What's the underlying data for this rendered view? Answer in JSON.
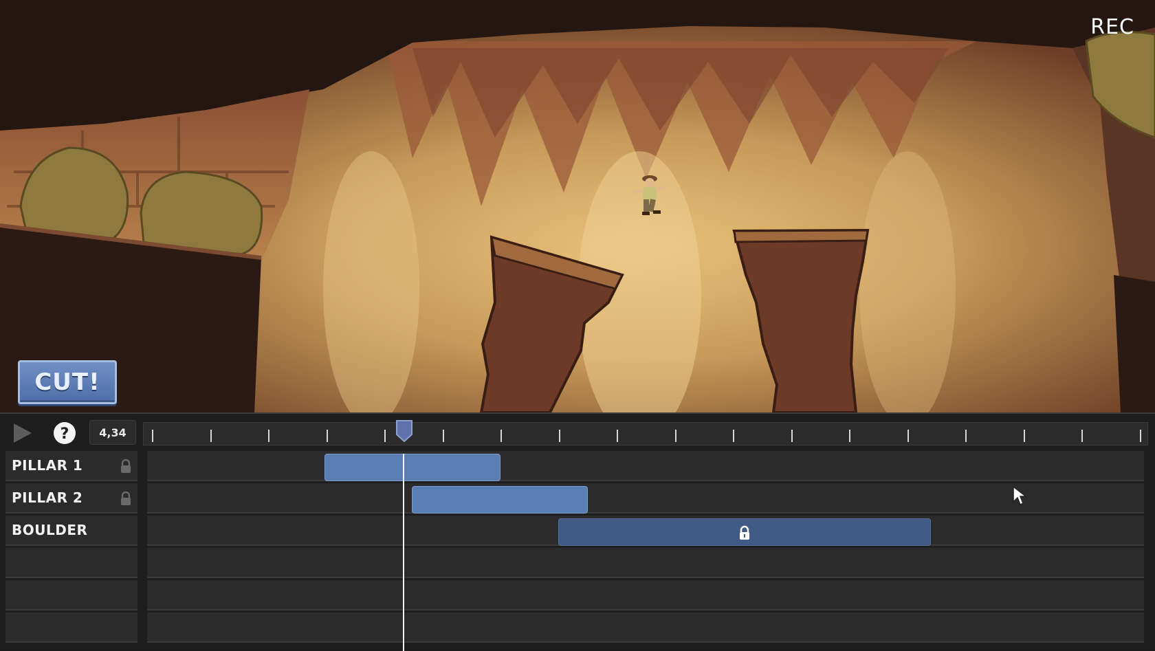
{
  "scene": {
    "rec_label": "REC",
    "cut_button_label": "CUT!",
    "character_icon": "explorer-character-icon"
  },
  "editor": {
    "play_icon": "play-icon",
    "help_icon": "help-icon",
    "time_readout": "4,34",
    "playhead_icon": "playhead-handle-icon",
    "tracks": [
      {
        "label": "PILLAR 1",
        "locked_icon": "lock-icon",
        "clip_locked": false
      },
      {
        "label": "PILLAR 2",
        "locked_icon": "lock-icon",
        "clip_locked": false
      },
      {
        "label": "BOULDER",
        "clip_locked": true,
        "clip_icon": "lock-icon"
      },
      {
        "label": ""
      },
      {
        "label": ""
      },
      {
        "label": ""
      }
    ]
  },
  "colors": {
    "clip_unlocked": "#5a7db3",
    "clip_locked": "#405a85",
    "cut_button": "#5a7bb5",
    "panel": "#2b2b2b"
  }
}
